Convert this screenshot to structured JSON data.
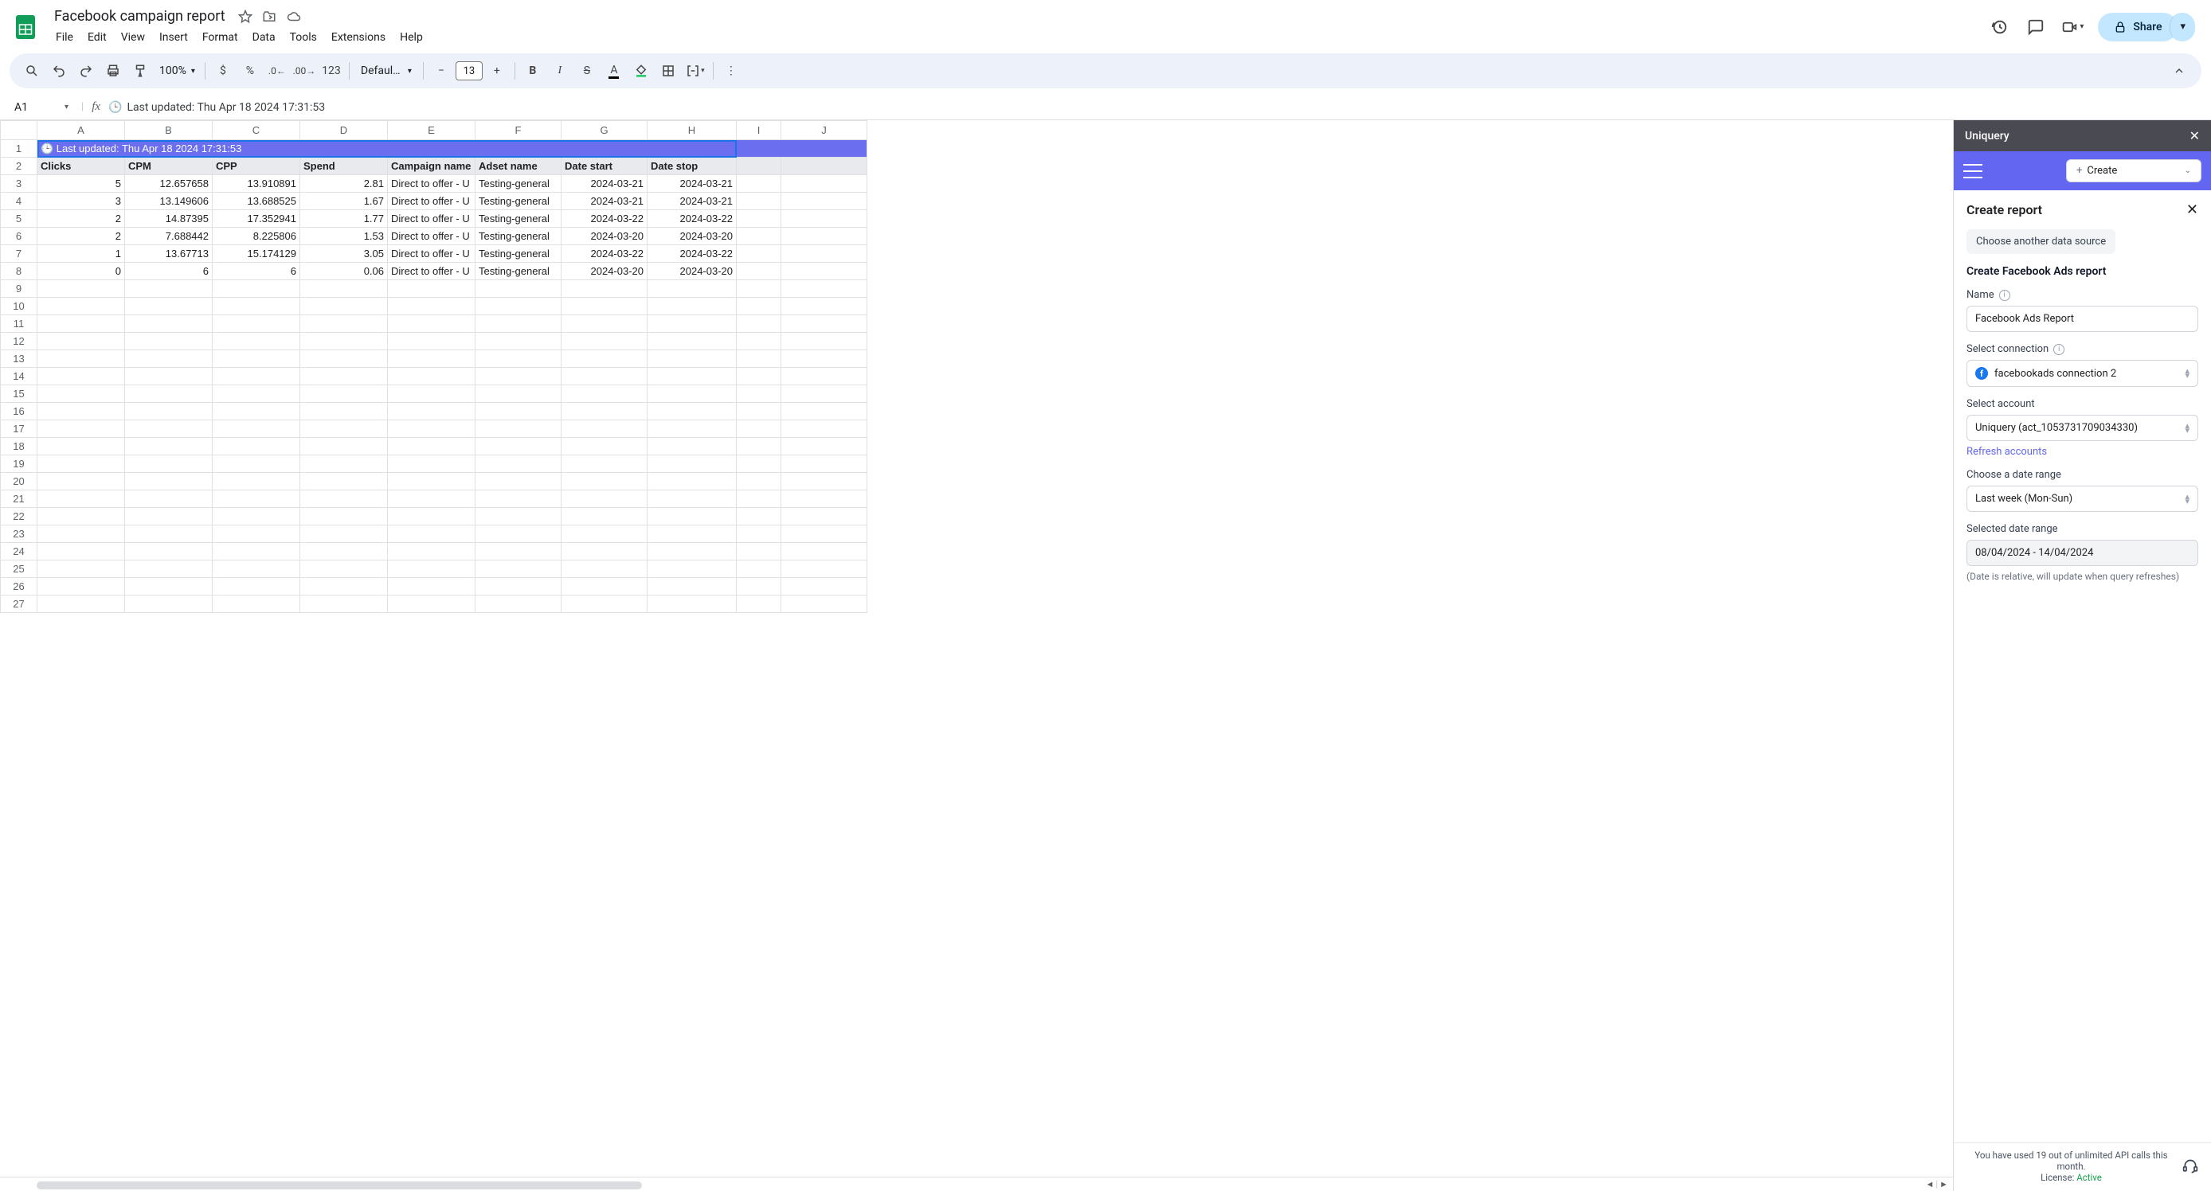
{
  "doc": {
    "title": "Facebook campaign report",
    "menus": [
      "File",
      "Edit",
      "View",
      "Insert",
      "Format",
      "Data",
      "Tools",
      "Extensions",
      "Help"
    ],
    "share_label": "Share"
  },
  "toolbar": {
    "zoom": "100%",
    "font": "Defaul…",
    "font_size": "13",
    "format_123": "123"
  },
  "formula_bar": {
    "cell_ref": "A1",
    "content": "Last updated: Thu Apr 18 2024 17:31:53"
  },
  "sheet": {
    "columns": [
      "A",
      "B",
      "C",
      "D",
      "E",
      "F",
      "G",
      "H",
      "I",
      "J"
    ],
    "banner": "🕒  Last updated: Thu Apr 18 2024 17:31:53",
    "headers": [
      "Clicks",
      "CPM",
      "CPP",
      "Spend",
      "Campaign name",
      "Adset name",
      "Date start",
      "Date stop"
    ],
    "rows": [
      {
        "clicks": "5",
        "cpm": "12.657658",
        "cpp": "13.910891",
        "spend": "2.81",
        "campaign": "Direct to offer - U",
        "adset": "Testing-general",
        "start": "2024-03-21",
        "stop": "2024-03-21"
      },
      {
        "clicks": "3",
        "cpm": "13.149606",
        "cpp": "13.688525",
        "spend": "1.67",
        "campaign": "Direct to offer - U",
        "adset": "Testing-general",
        "start": "2024-03-21",
        "stop": "2024-03-21"
      },
      {
        "clicks": "2",
        "cpm": "14.87395",
        "cpp": "17.352941",
        "spend": "1.77",
        "campaign": "Direct to offer - U",
        "adset": "Testing-general",
        "start": "2024-03-22",
        "stop": "2024-03-22"
      },
      {
        "clicks": "2",
        "cpm": "7.688442",
        "cpp": "8.225806",
        "spend": "1.53",
        "campaign": "Direct to offer - U",
        "adset": "Testing-general",
        "start": "2024-03-20",
        "stop": "2024-03-20"
      },
      {
        "clicks": "1",
        "cpm": "13.67713",
        "cpp": "15.174129",
        "spend": "3.05",
        "campaign": "Direct to offer - U",
        "adset": "Testing-general",
        "start": "2024-03-22",
        "stop": "2024-03-22"
      },
      {
        "clicks": "0",
        "cpm": "6",
        "cpp": "6",
        "spend": "0.06",
        "campaign": "Direct to offer - U",
        "adset": "Testing-general",
        "start": "2024-03-20",
        "stop": "2024-03-20"
      }
    ],
    "total_rows": 27
  },
  "panel": {
    "brand": "Uniquery",
    "create_label": "Create",
    "title": "Create report",
    "choose_source": "Choose another data source",
    "section_title": "Create Facebook Ads report",
    "name_label": "Name",
    "name_value": "Facebook Ads Report",
    "conn_label": "Select connection",
    "conn_value": "facebookads connection 2",
    "account_label": "Select account",
    "account_value": "Uniquery (act_1053731709034330)",
    "refresh_label": "Refresh accounts",
    "date_range_label": "Choose a date range",
    "date_range_value": "Last week (Mon-Sun)",
    "selected_range_label": "Selected date range",
    "selected_range_value": "08/04/2024 - 14/04/2024",
    "date_hint": "(Date is relative, will update when query refreshes)",
    "usage": "You have used 19 out of unlimited API calls this month.",
    "license_prefix": "License: ",
    "license_status": "Active"
  }
}
